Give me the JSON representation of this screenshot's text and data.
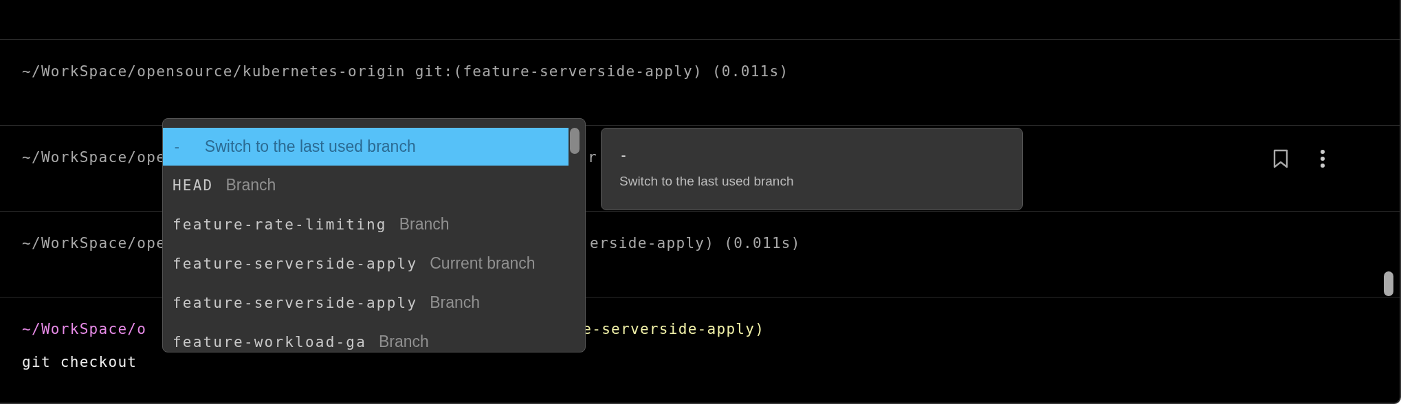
{
  "blocks": [
    {
      "kind": "output",
      "left": "~/WorkSpace/opensource/kubernetes-origin git:(feature-serverside-apply) (0.011s)",
      "hover_actions": false
    },
    {
      "kind": "output",
      "left": "~/WorkSpace/ope",
      "right": "r",
      "hover_actions": true
    },
    {
      "kind": "output",
      "left": "~/WorkSpace/ope",
      "right": "erside-apply) (0.011s)",
      "hover_actions": false
    }
  ],
  "prompt": {
    "path": "~/WorkSpace/o",
    "branch": "e-serverside-apply)",
    "command": "git checkout"
  },
  "completion_menu": {
    "items": [
      {
        "name": "-",
        "description": "Switch to the last used branch",
        "selected": true
      },
      {
        "name": "HEAD",
        "description": "Branch",
        "selected": false
      },
      {
        "name": "feature-rate-limiting",
        "description": "Branch",
        "selected": false
      },
      {
        "name": "feature-serverside-apply",
        "description": "Current branch",
        "selected": false
      },
      {
        "name": "feature-serverside-apply",
        "description": "Branch",
        "selected": false
      },
      {
        "name": "feature-workload-ga",
        "description": "Branch",
        "selected": false
      }
    ]
  },
  "detail_popup": {
    "title": "-",
    "description": "Switch to the last used branch"
  }
}
